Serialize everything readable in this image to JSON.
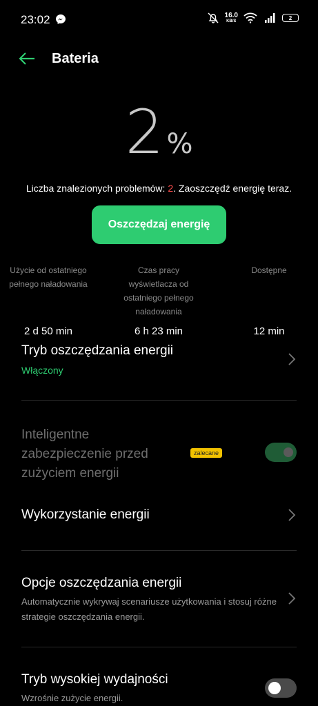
{
  "status_bar": {
    "time": "23:02",
    "net_speed_value": "16.0",
    "net_speed_unit": "KB/S",
    "battery_badge": "2",
    "icons": [
      "messenger-icon",
      "mute-icon",
      "wifi-icon",
      "signal-icon",
      "battery-icon"
    ]
  },
  "header": {
    "title": "Bateria"
  },
  "battery": {
    "percent": "2",
    "percent_sign": "%",
    "problems_prefix": "Liczba znalezionych problemów: ",
    "problems_count": "2",
    "problems_suffix": ". Zaoszczędź energię teraz.",
    "save_button_label": "Oszczędzaj energię"
  },
  "stats": [
    {
      "label": "Użycie od ostatniego pełnego naładowania",
      "value": "2 d 50 min"
    },
    {
      "label": "Czas pracy wyświetlacza od ostatniego pełnego naładowania",
      "value": "6 h 23 min"
    },
    {
      "label": "Dostępne",
      "value": "12 min"
    }
  ],
  "settings": {
    "power_saving_mode": {
      "title": "Tryb oszczędzania energii",
      "status": "Włączony"
    },
    "smart_protection": {
      "title": "Inteligentne zabezpieczenie przed zużyciem energii",
      "badge": "zalecane",
      "enabled": true
    },
    "power_usage": {
      "title": "Wykorzystanie energii"
    },
    "saving_options": {
      "title": "Opcje oszczędzania energii",
      "description": "Automatycznie wykrywaj scenariusze użytkowania i stosuj różne strategie oszczędzania energii."
    },
    "high_performance": {
      "title": "Tryb wysokiej wydajności",
      "description": "Wzrośnie zużycie energii.",
      "enabled": false
    }
  },
  "colors": {
    "accent_green": "#2ecc71",
    "problems_red": "#ff4d4d",
    "badge_yellow": "#f2c200"
  }
}
